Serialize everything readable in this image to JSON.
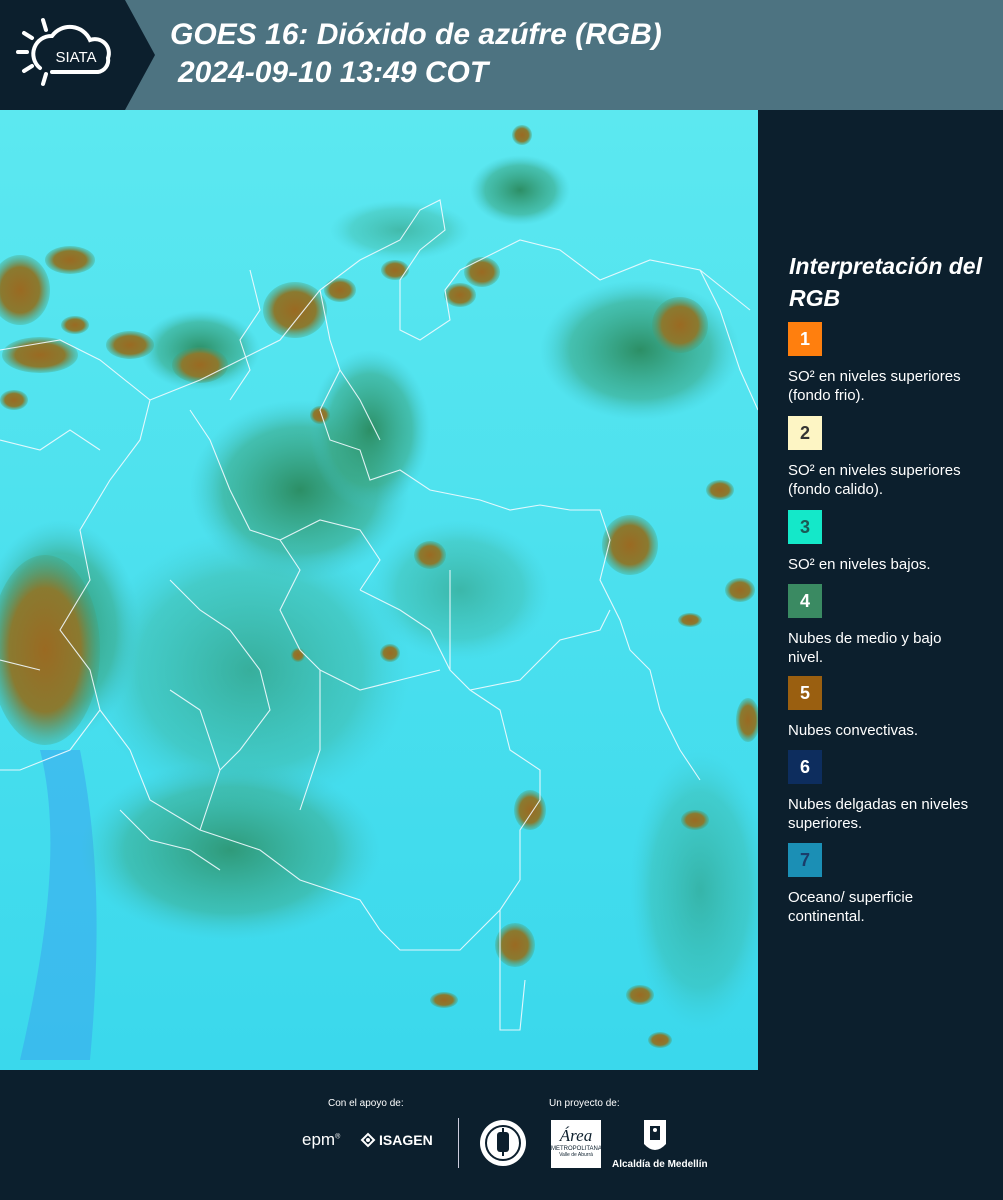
{
  "header": {
    "logo_text": "SIATA",
    "title_line1": "GOES 16: Dióxido de azúfre (RGB)",
    "title_line2": "2024-09-10 13:49 COT"
  },
  "legend": {
    "title": "Interpretación del RGB",
    "items": [
      {
        "num": "1",
        "color": "#ff7f0e",
        "text_color": "#ffffff",
        "label": "SO² en niveles superiores (fondo frio)."
      },
      {
        "num": "2",
        "color": "#fdf5c4",
        "text_color": "#333333",
        "label": "SO² en niveles superiores (fondo calido)."
      },
      {
        "num": "3",
        "color": "#14e8c9",
        "text_color": "#1a5a55",
        "label": "SO² en niveles bajos."
      },
      {
        "num": "4",
        "color": "#3a8a62",
        "text_color": "#ffffff",
        "label": "Nubes de medio y bajo nivel."
      },
      {
        "num": "5",
        "color": "#9a5f10",
        "text_color": "#ffffff",
        "label": "Nubes convectivas."
      },
      {
        "num": "6",
        "color": "#0d2d5e",
        "text_color": "#ffffff",
        "label": "Nubes delgadas en niveles superiores."
      },
      {
        "num": "7",
        "color": "#1b8fb5",
        "text_color": "#1a3d6a",
        "label": "Oceano/ superficie continental."
      }
    ]
  },
  "footer": {
    "support_label": "Con el apoyo de:",
    "project_label": "Un proyecto de:",
    "epm": "epm",
    "isagen": "ISAGEN",
    "area_name": "Área",
    "area_sub1": "METROPOLITANA",
    "area_sub2": "Valle de Aburrá",
    "alcaldia": "Alcaldía de Medellín"
  },
  "colors": {
    "map_base": "#3fe0ef",
    "map_green": "#2e8f63",
    "map_convective": "#8b6a28",
    "header_bg": "#4d7381",
    "panel_bg": "#0c1f2d"
  }
}
